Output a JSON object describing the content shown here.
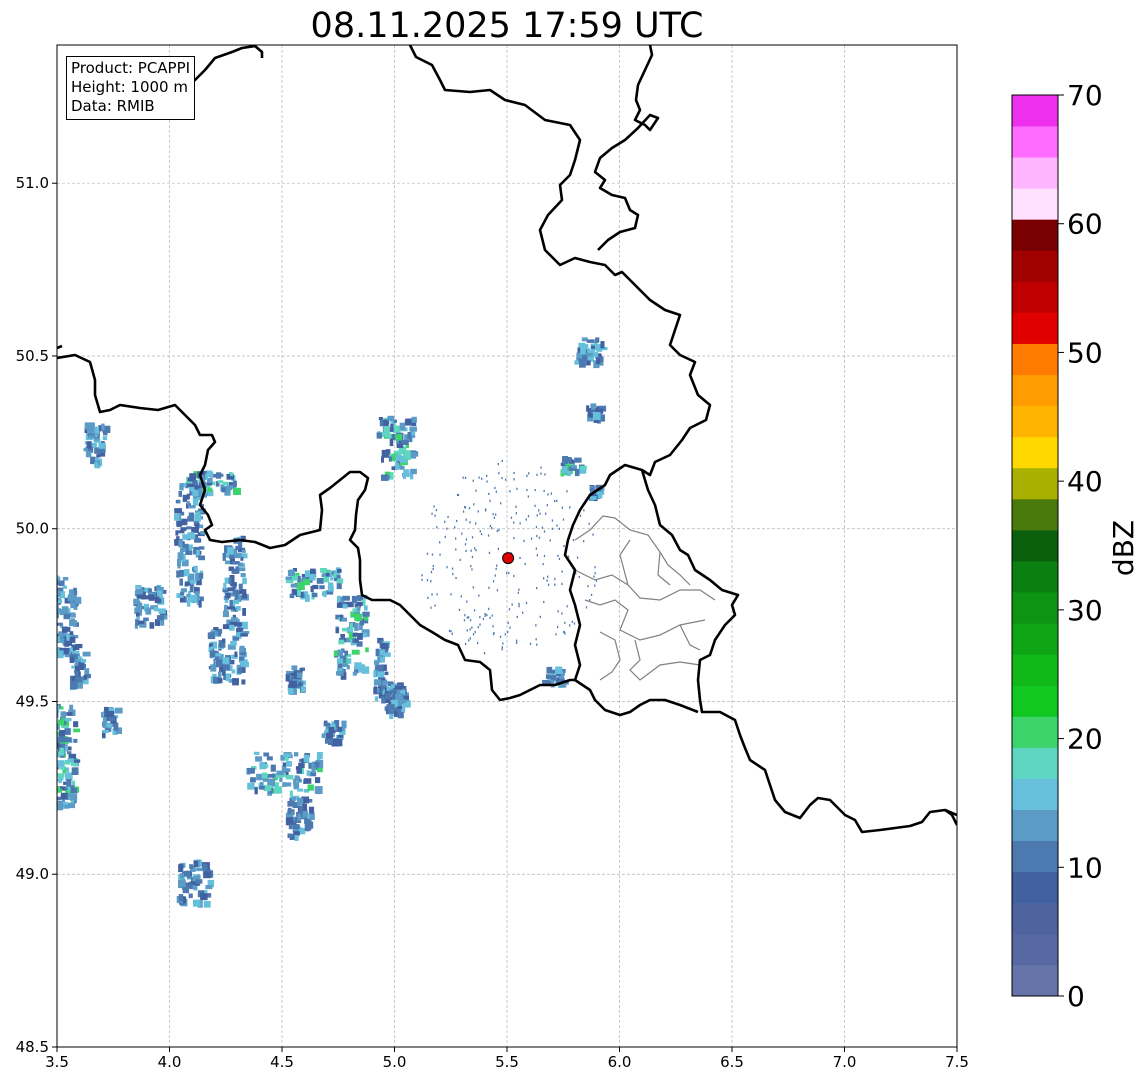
{
  "title": "08.11.2025 17:59 UTC",
  "info": {
    "product": "Product: PCAPPI",
    "height": "Height: 1000 m",
    "data": "Data: RMIB"
  },
  "chart_data": {
    "type": "heatmap",
    "title": "08.11.2025 17:59 UTC",
    "x_ticks": [
      3.5,
      4.0,
      4.5,
      5.0,
      5.5,
      6.0,
      6.5,
      7.0,
      7.5
    ],
    "y_ticks": [
      48.5,
      49.0,
      49.5,
      50.0,
      50.5,
      51.0
    ],
    "xlim": [
      3.5,
      7.5
    ],
    "ylim": [
      48.5,
      51.4
    ],
    "grid": true,
    "radar_site": {
      "lon": 5.505,
      "lat": 49.915,
      "color": "#e00000"
    },
    "colorbar": {
      "label": "dBZ",
      "min": 0,
      "max": 70,
      "step": 2.5,
      "ticks": [
        0,
        10,
        20,
        30,
        40,
        50,
        60,
        70
      ],
      "colors": [
        "#6574a8",
        "#5868a2",
        "#4f649f",
        "#4261a1",
        "#4b79b0",
        "#5b9bc6",
        "#66c0dc",
        "#5fd6c2",
        "#3dd46c",
        "#10c820",
        "#10b818",
        "#0ea614",
        "#0c9412",
        "#0b7f10",
        "#0a5f0c",
        "#4a7a0c",
        "#aab000",
        "#ffd800",
        "#ffb400",
        "#ff9c00",
        "#ff7c00",
        "#e00000",
        "#c00000",
        "#a00000",
        "#780000",
        "#ffe0ff",
        "#ffb4ff",
        "#ff6cff",
        "#ee30ee"
      ]
    }
  }
}
